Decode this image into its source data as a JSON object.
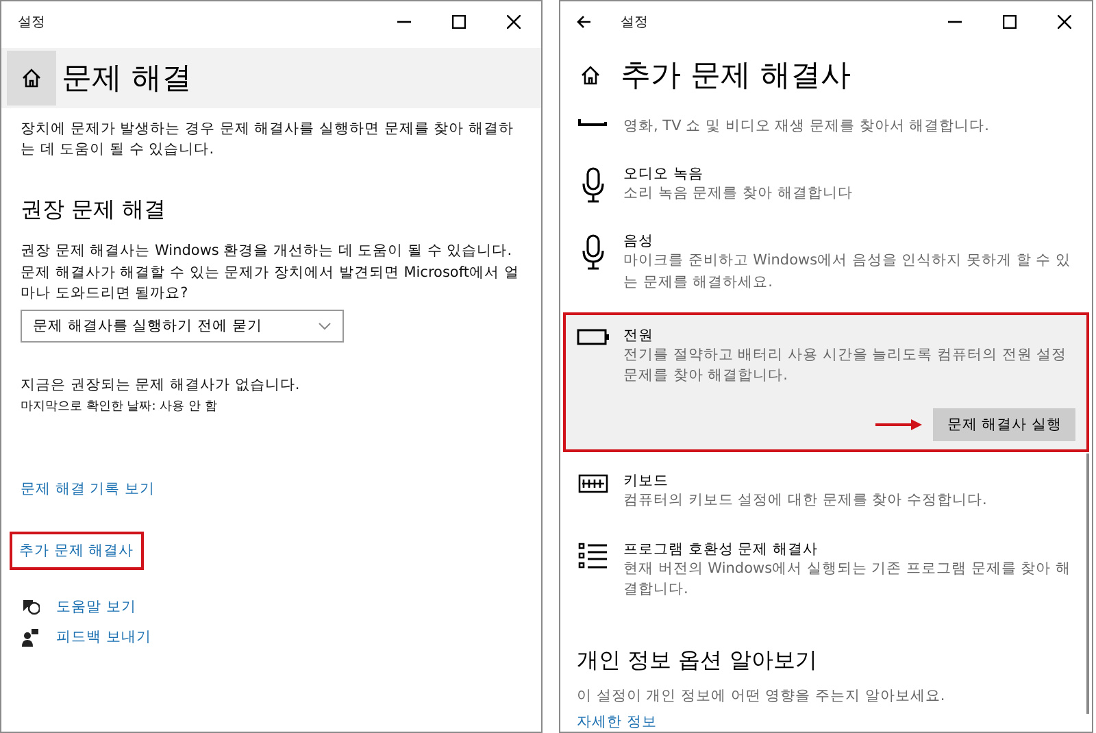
{
  "left_window": {
    "title": "설정",
    "heading": "문제 해결",
    "intro": "장치에 문제가 발생하는 경우 문제 해결사를 실행하면 문제를 찾아 해결하는 데 도움이 될 수 있습니다.",
    "section_heading": "권장 문제 해결",
    "section_text": "권장 문제 해결사는 Windows 환경을 개선하는 데 도움이 될 수 있습니다. 문제 해결사가 해결할 수 있는 문제가 장치에서 발견되면 Microsoft에서 얼마나 도와드리면 될까요?",
    "dropdown": {
      "value": "문제 해결사를 실행하기 전에 묻기"
    },
    "status": "지금은 권장되는 문제 해결사가 없습니다.",
    "last_checked": "마지막으로 확인한 날짜: 사용 안 함",
    "links": [
      {
        "label": "문제 해결 기록 보기",
        "highlighted": false
      },
      {
        "label": "추가 문제 해결사",
        "highlighted": true
      }
    ],
    "help_links": [
      {
        "kind": "help",
        "label": "도움말 보기"
      },
      {
        "kind": "feedback",
        "label": "피드백 보내기"
      }
    ]
  },
  "right_window": {
    "title": "설정",
    "heading": "추가 문제 해결사",
    "troubleshooters": [
      {
        "kind": "video",
        "description": "영화, TV 쇼 및 비디오 재생 문제를 찾아서 해결합니다.",
        "selected": false,
        "highlighted": false
      },
      {
        "kind": "mic",
        "title": "오디오 녹음",
        "description": "소리 녹음 문제를 찾아 해결합니다",
        "selected": false,
        "highlighted": false
      },
      {
        "kind": "mic",
        "title": "음성",
        "description": "마이크를 준비하고 Windows에서 음성을 인식하지 못하게 할 수 있는 문제를 해결하세요.",
        "selected": false,
        "highlighted": false
      },
      {
        "kind": "battery",
        "title": "전원",
        "description": "전기를 절약하고 배터리 사용 시간을 늘리도록 컴퓨터의 전원 설정 문제를 찾아 해결합니다.",
        "selected": true,
        "highlighted": true,
        "run_button": "문제 해결사 실행"
      },
      {
        "kind": "keyboard",
        "title": "키보드",
        "description": "컴퓨터의 키보드 설정에 대한 문제를 찾아 수정합니다.",
        "selected": false,
        "highlighted": false
      },
      {
        "kind": "list",
        "title": "프로그램 호환성 문제 해결사",
        "description": "현재 버전의 Windows에서 실행되는 기존 프로그램 문제를 찾아 해결합니다.",
        "selected": false,
        "highlighted": false
      }
    ],
    "privacy": {
      "heading": "개인 정보 옵션 알아보기",
      "text": "이 설정이 개인 정보에 어떤 영향을 주는지 알아보세요.",
      "link": "자세한 정보"
    }
  }
}
